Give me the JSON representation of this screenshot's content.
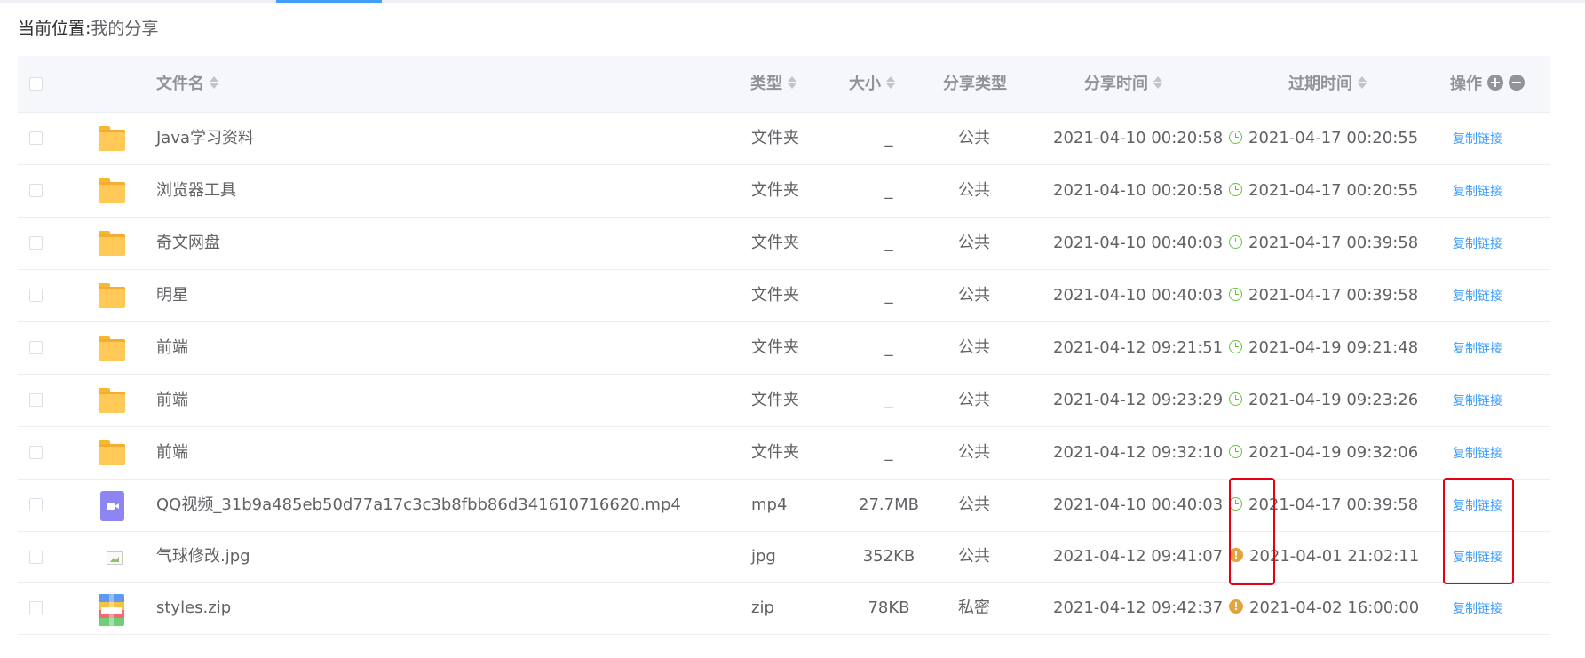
{
  "breadcrumb": {
    "label": "当前位置:",
    "value": "我的分享"
  },
  "columns": {
    "name": "文件名",
    "type": "类型",
    "size": "大小",
    "share_type": "分享类型",
    "share_time": "分享时间",
    "expire_time": "过期时间",
    "actions": "操作"
  },
  "header_buttons": {
    "expand": "+",
    "collapse": "−"
  },
  "rows": [
    {
      "icon": "folder-icon",
      "name": "Java学习资料",
      "type": "文件夹",
      "size": "_",
      "share_type": "公共",
      "share_time": "2021-04-10 00:20:58",
      "status_icon": "clock-icon",
      "expire_time": "2021-04-17 00:20:55",
      "action": "复制链接"
    },
    {
      "icon": "folder-icon",
      "name": "浏览器工具",
      "type": "文件夹",
      "size": "_",
      "share_type": "公共",
      "share_time": "2021-04-10 00:20:58",
      "status_icon": "clock-icon",
      "expire_time": "2021-04-17 00:20:55",
      "action": "复制链接"
    },
    {
      "icon": "folder-icon",
      "name": "奇文网盘",
      "type": "文件夹",
      "size": "_",
      "share_type": "公共",
      "share_time": "2021-04-10 00:40:03",
      "status_icon": "clock-icon",
      "expire_time": "2021-04-17 00:39:58",
      "action": "复制链接"
    },
    {
      "icon": "folder-icon",
      "name": "明星",
      "type": "文件夹",
      "size": "_",
      "share_type": "公共",
      "share_time": "2021-04-10 00:40:03",
      "status_icon": "clock-icon",
      "expire_time": "2021-04-17 00:39:58",
      "action": "复制链接"
    },
    {
      "icon": "folder-icon",
      "name": "前端",
      "type": "文件夹",
      "size": "_",
      "share_type": "公共",
      "share_time": "2021-04-12 09:21:51",
      "status_icon": "clock-icon",
      "expire_time": "2021-04-19 09:21:48",
      "action": "复制链接"
    },
    {
      "icon": "folder-icon",
      "name": "前端",
      "type": "文件夹",
      "size": "_",
      "share_type": "公共",
      "share_time": "2021-04-12 09:23:29",
      "status_icon": "clock-icon",
      "expire_time": "2021-04-19 09:23:26",
      "action": "复制链接"
    },
    {
      "icon": "folder-icon",
      "name": "前端",
      "type": "文件夹",
      "size": "_",
      "share_type": "公共",
      "share_time": "2021-04-12 09:32:10",
      "status_icon": "clock-icon",
      "expire_time": "2021-04-19 09:32:06",
      "action": "复制链接"
    },
    {
      "icon": "video-icon",
      "name": "QQ视频_31b9a485eb50d77a17c3c3b8fbb86d341610716620.mp4",
      "type": "mp4",
      "size": "27.7MB",
      "share_type": "公共",
      "share_time": "2021-04-10 00:40:03",
      "status_icon": "clock-icon",
      "expire_time": "2021-04-17 00:39:58",
      "action": "复制链接"
    },
    {
      "icon": "broken-image-icon",
      "name": "气球修改.jpg",
      "type": "jpg",
      "size": "352KB",
      "share_type": "公共",
      "share_time": "2021-04-12 09:41:07",
      "status_icon": "warning-icon",
      "expire_time": "2021-04-01 21:02:11",
      "action": "复制链接"
    },
    {
      "icon": "zip-icon",
      "name": "styles.zip",
      "type": "zip",
      "size": "78KB",
      "share_type": "私密",
      "share_time": "2021-04-12 09:42:37",
      "status_icon": "warning-icon",
      "expire_time": "2021-04-02 16:00:00",
      "action": "复制链接"
    }
  ],
  "colors": {
    "accent": "#409eff",
    "valid": "#67c23a",
    "expired": "#e6a23c",
    "highlight": "#e60012"
  }
}
